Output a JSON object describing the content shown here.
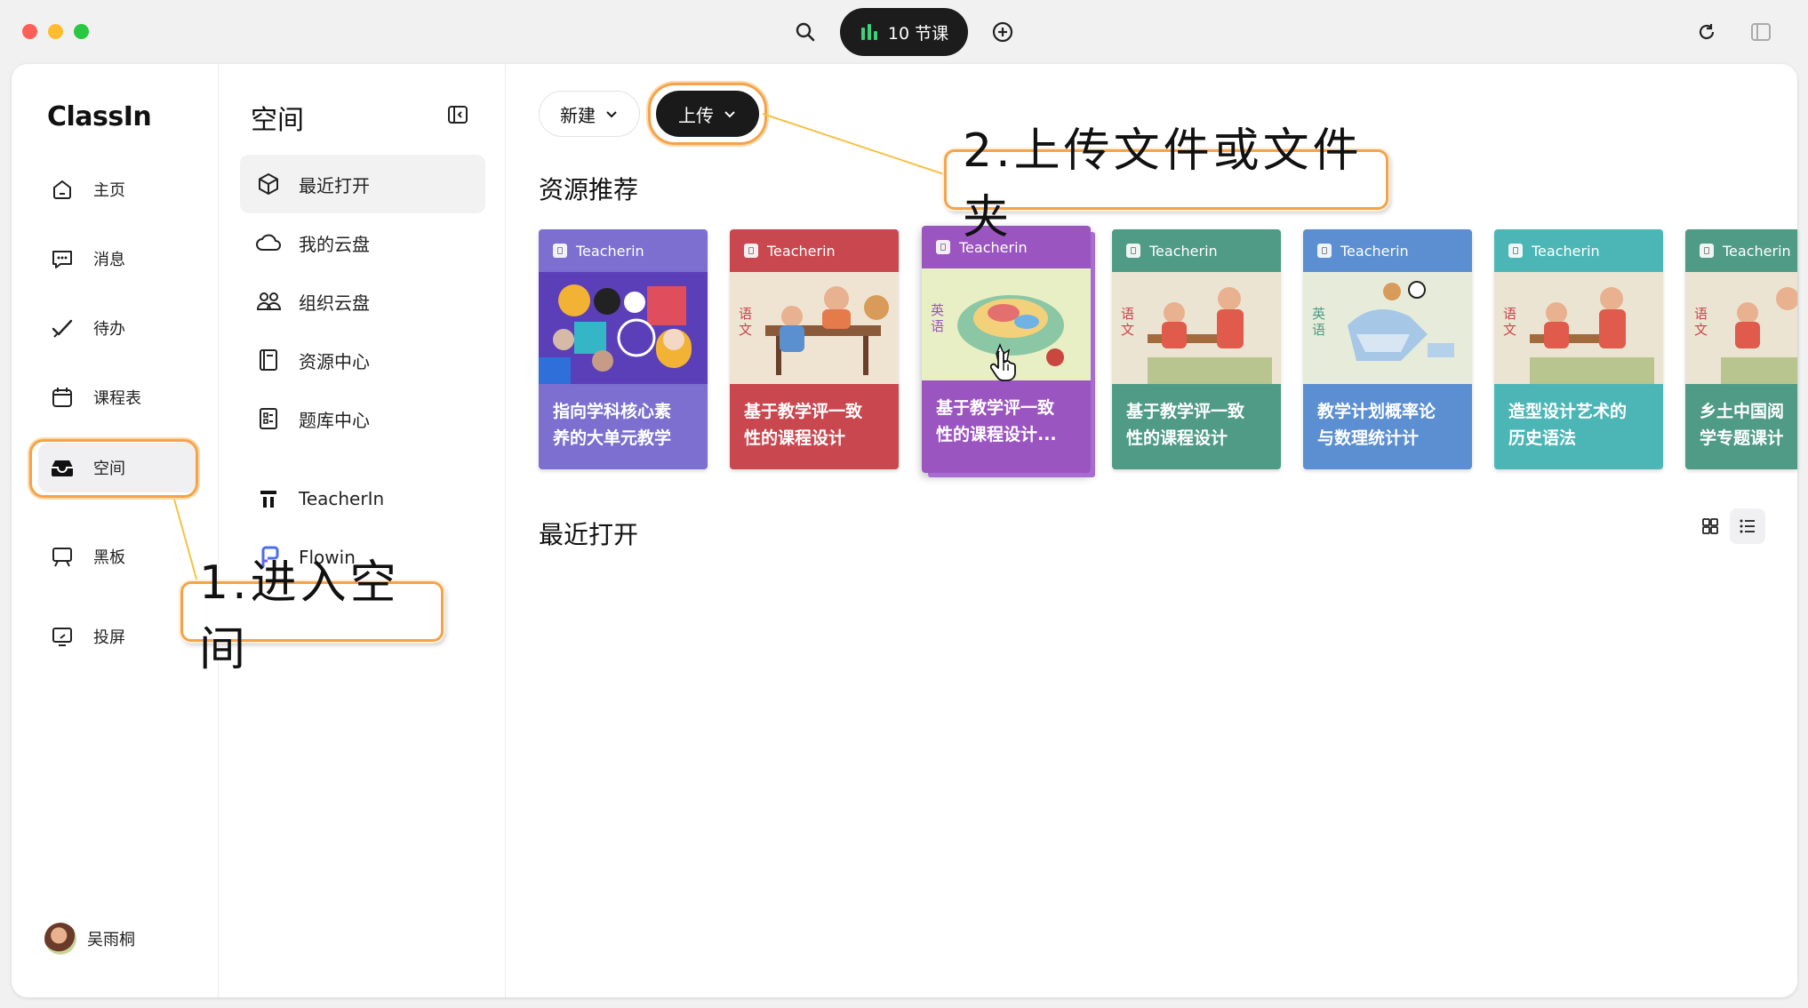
{
  "topbar": {
    "lesson_count": "10 节课"
  },
  "nav": {
    "logo": "ClassIn",
    "items": [
      {
        "label": "主页"
      },
      {
        "label": "消息"
      },
      {
        "label": "待办"
      },
      {
        "label": "课程表"
      },
      {
        "label": "空间"
      },
      {
        "label": "黑板"
      },
      {
        "label": "投屏"
      }
    ],
    "user": "吴雨桐"
  },
  "panel": {
    "title": "空间",
    "items": [
      {
        "label": "最近打开"
      },
      {
        "label": "我的云盘"
      },
      {
        "label": "组织云盘"
      },
      {
        "label": "资源中心"
      },
      {
        "label": "题库中心"
      },
      {
        "label": "TeacherIn"
      },
      {
        "label": "Flowin"
      }
    ]
  },
  "main": {
    "new_label": "新建",
    "upload_label": "上传",
    "recommend_title": "资源推荐",
    "recent_title": "最近打开",
    "cards": [
      {
        "brand": "Teacherin",
        "line1": "指向学科核心素",
        "line2": "养的大单元教学",
        "color": "#7d6fd0"
      },
      {
        "brand": "Teacherin",
        "line1": "基于教学评一致",
        "line2": "性的课程设计",
        "color": "#c9474f"
      },
      {
        "brand": "Teacherin",
        "line1": "基于教学评一致",
        "line2": "性的课程设计...",
        "color": "#9b55c1"
      },
      {
        "brand": "Teacherin",
        "line1": "基于教学评一致",
        "line2": "性的课程设计",
        "color": "#4f9b85"
      },
      {
        "brand": "Teacherin",
        "line1": "教学计划概率论",
        "line2": "与数理统计计",
        "color": "#5b8fd1"
      },
      {
        "brand": "Teacherin",
        "line1": "造型设计艺术的",
        "line2": "历史语法",
        "color": "#4cb6b6"
      },
      {
        "brand": "Teacherin",
        "line1": "乡土中国阅读",
        "line2": "学专题课计",
        "color": "#4f9b85"
      }
    ]
  },
  "annotations": {
    "step1": "1.进入空间",
    "step2": "2.上传文件或文件夹"
  }
}
